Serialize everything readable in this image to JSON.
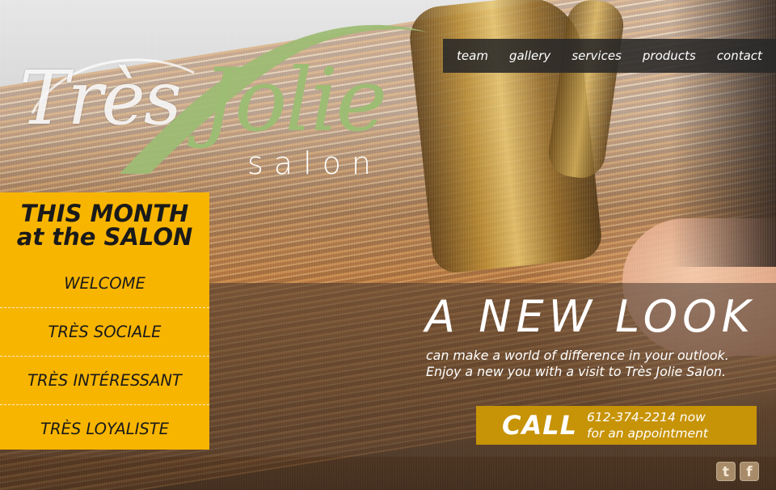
{
  "logo": {
    "tres": "Très",
    "jolie": "Jolie",
    "salon": "salon"
  },
  "nav": {
    "items": [
      "team",
      "gallery",
      "services",
      "products",
      "contact"
    ]
  },
  "panel": {
    "title_line1": "THIS MONTH",
    "title_line2": "at the SALON",
    "items": [
      "WELCOME",
      "TRÈS SOCIALE",
      "TRÈS INTÉRESSANT",
      "TRÈS LOYALISTE"
    ],
    "background_color": "#f8b500"
  },
  "hero": {
    "headline": "A NEW LOOK",
    "subline1": "can make a world of difference in your outlook.",
    "subline2": "Enjoy a new you with a visit to Très Jolie Salon."
  },
  "call": {
    "word": "CALL",
    "phone_line": "612-374-2214 now",
    "appointment_line": "for an appointment",
    "background_color": "#c79307"
  },
  "social": {
    "icons": [
      "twitter-icon",
      "facebook-icon"
    ],
    "twitter_glyph": "t",
    "facebook_glyph": "f"
  },
  "colors": {
    "accent_green": "#9dbc74",
    "nav_bg": "#282828"
  }
}
